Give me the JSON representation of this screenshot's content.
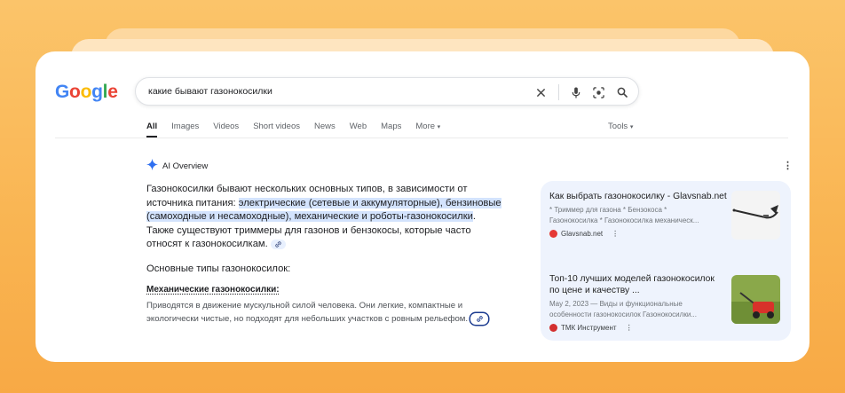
{
  "logo": {
    "letters": [
      "G",
      "o",
      "o",
      "g",
      "l",
      "e"
    ],
    "colors": [
      "#4285F4",
      "#EA4335",
      "#FBBC05",
      "#4285F4",
      "#34A853",
      "#EA4335"
    ]
  },
  "search": {
    "query": "какие бывают газонокосилки"
  },
  "tabs": [
    {
      "label": "All",
      "active": true
    },
    {
      "label": "Images"
    },
    {
      "label": "Videos"
    },
    {
      "label": "Short videos"
    },
    {
      "label": "News"
    },
    {
      "label": "Web"
    },
    {
      "label": "Maps"
    },
    {
      "label": "More"
    }
  ],
  "tools_label": "Tools",
  "ai_overview": {
    "label": "AI Overview",
    "intro_1": "Газонокосилки бывают нескольких основных типов, в зависимости от источника питания: ",
    "intro_hl": "электрические (сетевые и аккумуляторные), бензиновые (самоходные и несамоходные), механические и роботы-газонокосилки",
    "intro_2": ". Также существуют триммеры для газонов и бензокосы, которые часто относят к газонокосилкам.",
    "subheading": "Основные типы газонокосилок:",
    "section_title": "Механические газонокосилки:",
    "section_text": "Приводятся в движение мускульной силой человека. Они легкие, компактные и экологически чистые, но подходят для небольших участков с ровным рельефом."
  },
  "sources": [
    {
      "title": "Как выбрать газонокосилку - Glavsnab.net",
      "snippet_1": "* Триммер для газона * Бензокоса *",
      "snippet_2": "Газонокосилка * Газонокосилка механическ...",
      "site": "Glavsnab.net",
      "favicon_color": "#e53935"
    },
    {
      "title": "Топ-10 лучших моделей газонокосилок по цене и качеству ...",
      "snippet_1": "May 2, 2023 — Виды и функциональные",
      "snippet_2": "особенности газонокосилок Газонокосилки...",
      "site": "ТМК Инструмент",
      "favicon_color": "#d32f2f"
    }
  ]
}
